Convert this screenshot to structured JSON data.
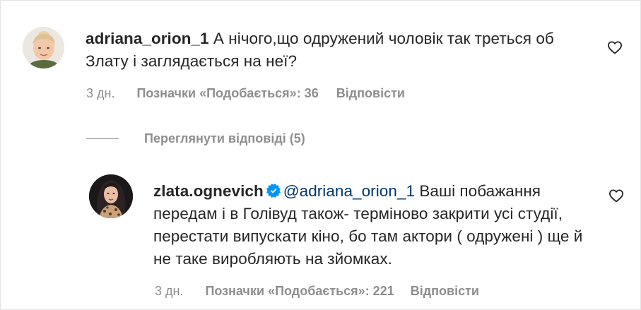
{
  "comments": [
    {
      "username": "adriana_orion_1",
      "text": "А нічого,що одружений чоловік так треться об Злату і заглядається на неї?",
      "time": "3 дн.",
      "likes": "Позначки «Подобається»: 36",
      "reply": "Відповісти",
      "view_replies": "Переглянути відповіді (5)"
    },
    {
      "username": "zlata.ognevich",
      "verified": true,
      "mention": "@adriana_orion_1",
      "text": "Ваші побажання передам і в Голівуд також- терміново закрити усі студії, перестати випускати кіно, бо там актори ( одружені ) ще й не таке виробляють на зйомках.",
      "time": "3 дн.",
      "likes": "Позначки «Подобається»: 221",
      "reply": "Відповісти"
    }
  ],
  "colors": {
    "text": "#262626",
    "secondary": "#8e8e8e",
    "mention": "#00376b",
    "verified": "#0095f6"
  },
  "icons": {
    "like": "heart-outline-icon",
    "verified": "verified-badge-icon"
  }
}
